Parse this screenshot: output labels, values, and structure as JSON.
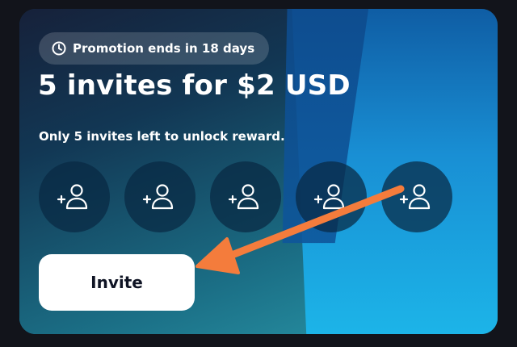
{
  "promo": {
    "icon": "clock-icon",
    "text": "Promotion ends in 18 days"
  },
  "headline": "5 invites for $2 USD",
  "subtext": "Only 5 invites left to unlock reward.",
  "invite_slots": [
    {
      "icon": "add-person-icon"
    },
    {
      "icon": "add-person-icon"
    },
    {
      "icon": "add-person-icon"
    },
    {
      "icon": "add-person-icon"
    },
    {
      "icon": "add-person-icon"
    }
  ],
  "invite_button": {
    "label": "Invite"
  },
  "colors": {
    "page_background": "#12141b",
    "button_background": "#ffffff",
    "button_text": "#0f1424",
    "annotation_arrow": "#f47c3c"
  }
}
